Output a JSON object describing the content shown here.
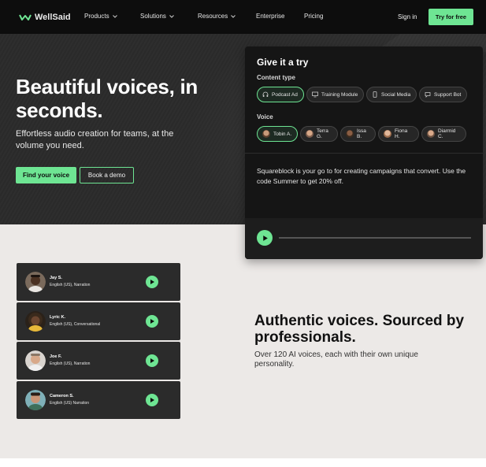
{
  "nav": {
    "logo_text": "WellSaid",
    "items": [
      {
        "label": "Products",
        "has_dropdown": true
      },
      {
        "label": "Solutions",
        "has_dropdown": true
      },
      {
        "label": "Resources",
        "has_dropdown": true
      },
      {
        "label": "Enterprise",
        "has_dropdown": false
      },
      {
        "label": "Pricing",
        "has_dropdown": false
      }
    ],
    "signin_label": "Sign in",
    "cta_label": "Try for free"
  },
  "hero": {
    "title": "Beautiful voices, in seconds.",
    "subtitle": "Effortless audio creation for teams, at the volume you need.",
    "primary_button": "Find your voice",
    "secondary_button": "Book a demo"
  },
  "try_panel": {
    "title": "Give it a try",
    "content_type_label": "Content type",
    "content_types": [
      {
        "label": "Podcast Ad",
        "icon": "headphones-icon",
        "active": true
      },
      {
        "label": "Training Module",
        "icon": "monitor-icon",
        "active": false
      },
      {
        "label": "Social Media",
        "icon": "phone-icon",
        "active": false
      },
      {
        "label": "Support Bot",
        "icon": "chat-icon",
        "active": false
      }
    ],
    "voice_label": "Voice",
    "voices": [
      {
        "label": "Tobin A.",
        "active": true
      },
      {
        "label": "Terra G.",
        "active": false
      },
      {
        "label": "Issa B.",
        "active": false
      },
      {
        "label": "Fiona H.",
        "active": false
      },
      {
        "label": "Diarmid C.",
        "active": false
      }
    ],
    "script_text": "Squareblock is your go to for creating campaigns that convert. Use the code Summer to get 20% off.",
    "progress": 0
  },
  "voice_cards": [
    {
      "name": "Jay S.",
      "meta": "English (US), Narration"
    },
    {
      "name": "Lyric K.",
      "meta": "English (US), Conversational"
    },
    {
      "name": "Joe F.",
      "meta": "English (US), Narration"
    },
    {
      "name": "Cameron S.",
      "meta": "English (US) Narration"
    }
  ],
  "authentic": {
    "title": "Authentic voices. Sourced by professionals.",
    "subtitle": "Over 120 AI voices, each with their own unique personality."
  },
  "colors": {
    "accent": "#6ee593",
    "nav_bg": "#0d0d0d",
    "hero_bg": "#2b2b2b",
    "panel_bg": "#151515",
    "lower_bg": "#ece9e7"
  }
}
